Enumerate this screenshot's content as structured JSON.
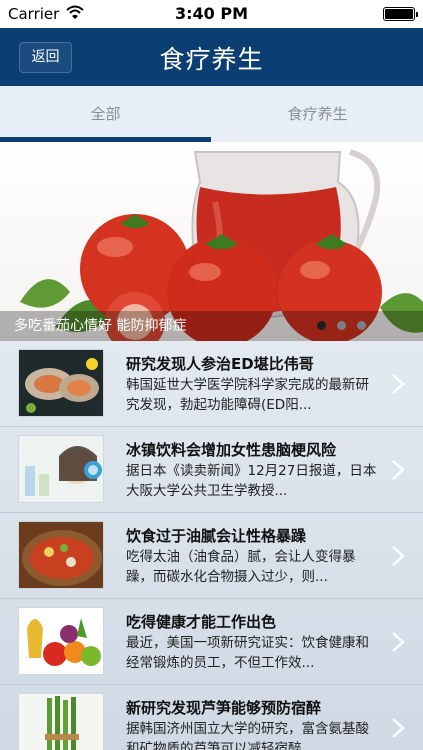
{
  "status_bar": {
    "carrier": "Carrier",
    "time": "3:40 PM"
  },
  "nav": {
    "back_label": "返回",
    "title": "食疗养生"
  },
  "tabs": [
    {
      "label": "全部",
      "selected": true
    },
    {
      "label": "食疗养生",
      "selected": false
    }
  ],
  "hero": {
    "caption": "多吃番茄心情好 能防抑郁症",
    "pager": {
      "count": 3,
      "active_index": 0
    }
  },
  "articles": [
    {
      "title": "研究发现人参治ED堪比伟哥",
      "summary": "韩国延世大学医学院科学家完成的最新研究发现，勃起功能障碍(ED阳..."
    },
    {
      "title": "冰镇饮料会增加女性患脑梗风险",
      "summary": "据日本《读卖新闻》12月27日报道，日本大阪大学公共卫生学教授..."
    },
    {
      "title": "饮食过于油腻会让性格暴躁",
      "summary": "吃得太油（油食品）腻，会让人变得暴躁，而碳水化合物摄入过少，则..."
    },
    {
      "title": "吃得健康才能工作出色",
      "summary": "最近，美国一项新研究证实：饮食健康和经常锻炼的员工，不但工作效..."
    },
    {
      "title": "新研究发现芦笋能够预防宿醉",
      "summary": "据韩国济州国立大学的研究，富含氨基酸和矿物质的芦笋可以减轻宿醉..."
    }
  ]
}
